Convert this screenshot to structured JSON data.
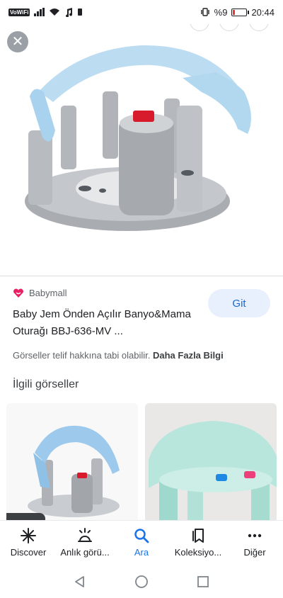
{
  "status_bar": {
    "network_badge": "VoWiFi",
    "battery_percent": "%9",
    "time": "20:44"
  },
  "hero": {
    "close_icon": "close-icon"
  },
  "result": {
    "source": "Babymall",
    "title": "Baby Jem Önden Açılır Banyo&Mama Oturağı BBJ-636-MV ...",
    "visit_label": "Git"
  },
  "license": {
    "text": "Görseller telif hakkına tabi olabilir.",
    "link": "Daha Fazla Bilgi"
  },
  "related": {
    "heading": "İlgili görseller"
  },
  "bottom_nav": {
    "items": [
      {
        "label": "Discover",
        "icon": "asterisk-icon"
      },
      {
        "label": "Anlık görü...",
        "icon": "updates-icon"
      },
      {
        "label": "Ara",
        "icon": "search-icon"
      },
      {
        "label": "Koleksiyo...",
        "icon": "collections-icon"
      },
      {
        "label": "Diğer",
        "icon": "more-icon"
      }
    ]
  },
  "colors": {
    "accent": "#1a73e8",
    "button_bg": "#e8f0fe",
    "source_logo": "#e91e63"
  }
}
